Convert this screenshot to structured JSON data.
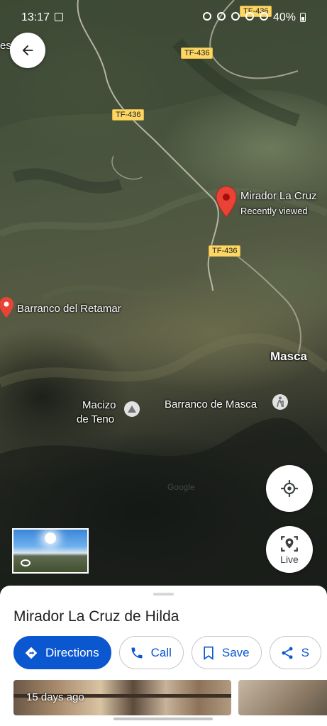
{
  "status_bar": {
    "time": "13:17",
    "battery": "40%"
  },
  "map": {
    "road_labels": [
      "TF-436",
      "TF-436",
      "TF-436",
      "TF-436"
    ],
    "selected_pin": {
      "name": "Mirador La Cruz",
      "subtitle": "Recently viewed",
      "color": "#ea4335"
    },
    "pin_retamar": "Barranco del Retamar",
    "place_masca": "Masca",
    "place_teno_line1": "Macizo",
    "place_teno_line2": "de Teno",
    "place_barranco_masca": "Barranco de Masca",
    "edge_label": "es",
    "watermark": "Google"
  },
  "buttons": {
    "back_icon": "arrow-back-icon",
    "locate_icon": "my-location-icon",
    "live_label": "Live"
  },
  "sheet": {
    "title": "Mirador La Cruz de Hilda",
    "actions": {
      "directions": "Directions",
      "call": "Call",
      "save": "Save",
      "share": "S"
    },
    "photo_age": "15 days ago",
    "accent": "#0b57d0"
  }
}
